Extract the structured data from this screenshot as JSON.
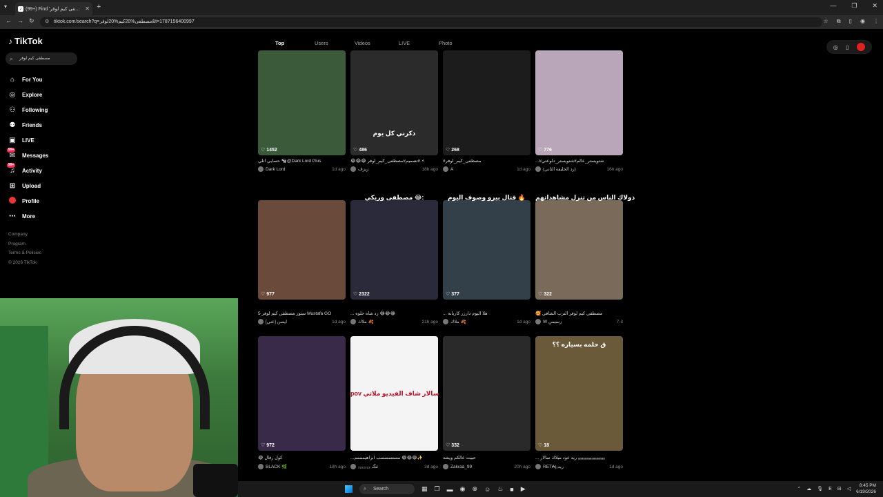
{
  "browser": {
    "tab_title": "(99+) Find 'مصطفى كيم لوفر' on...",
    "url": "tiktok.com/search?q=مصطفى%20كيم%20لوفر&t=1787156400997",
    "new_tab_label": "+",
    "window_controls": [
      "—",
      "❐",
      "✕"
    ]
  },
  "sidebar": {
    "logo_text": "TikTok",
    "search_value": "مصطفى كيم لوفر",
    "items": [
      {
        "label": "For You",
        "icon": "home-icon"
      },
      {
        "label": "Explore",
        "icon": "compass-icon"
      },
      {
        "label": "Following",
        "icon": "user-follow-icon"
      },
      {
        "label": "Friends",
        "icon": "friends-icon"
      },
      {
        "label": "LIVE",
        "icon": "live-icon"
      },
      {
        "label": "Messages",
        "icon": "message-icon",
        "badge": "99+"
      },
      {
        "label": "Activity",
        "icon": "bell-icon",
        "badge": "99+"
      },
      {
        "label": "Upload",
        "icon": "plus-icon"
      },
      {
        "label": "Profile",
        "icon": "avatar-icon"
      },
      {
        "label": "More",
        "icon": "more-icon"
      }
    ],
    "footer": [
      "Company",
      "Program",
      "Terms & Policies",
      "© 2026 TikTok"
    ]
  },
  "tabs": [
    "Top",
    "Users",
    "Videos",
    "LIVE",
    "Photo"
  ],
  "videos": [
    {
      "likes": "1452",
      "caption": "حسابي اتلي 🐄@Dark Lord Plus",
      "author": "Dark Lord",
      "time": "1d ago",
      "overlay": "",
      "bg": "#3a5a3a"
    },
    {
      "likes": "486",
      "caption": "😂😂😂 تصميم#مصطفى_كيم_لوفر# ⚡",
      "author": "زيزف",
      "time": "18h ago",
      "overlay": "ذكرني كل يوم",
      "bg": "#2b2b2b"
    },
    {
      "likes": "268",
      "caption": "#مصطفى_كيم_لوفر",
      "author": "A",
      "time": "1d ago",
      "overlay": "",
      "bg": "#1c1c1c"
    },
    {
      "likes": "776",
      "caption": "...#شتويستر_عالم#شتويستر_دلوعتي",
      "author": "(رد الخليفه الثاني)",
      "time": "16h ago",
      "overlay": "",
      "bg": "#b9a6b9"
    },
    {
      "likes": "977",
      "caption": "5 ستور مصطفى كيم لوفر Mustafa GO",
      "author": "ايسن [عني]",
      "time": "1d ago",
      "overlay": "",
      "bg": "#6a4a3a"
    },
    {
      "likes": "2322",
      "caption": "... زد شاه حلوه 😂😂😂",
      "author": "ملاك 🍂",
      "time": "21h ago",
      "overlay": "مصطفى وريكي 😂:",
      "bg": "#2a2a3a"
    },
    {
      "likes": "377",
      "caption": "... هلا اليوم داررر كاريانه",
      "author": "ملاك 🍂",
      "time": "1d ago",
      "overlay": "قتال بيرو وصوف اليوم 🔥",
      "bg": "#33404a"
    },
    {
      "likes": "322",
      "caption": "🥰 مصطفى كيم لوفر الترب الشافي",
      "author": "W زنميمن",
      "time": "7-3",
      "overlay": "ذولاك الناس من تنزل مشاهداتهم",
      "bg": "#7a6a5a"
    },
    {
      "likes": "972",
      "caption": "😂 كول رفال",
      "author": "BLACK 🌿",
      "time": "18h ago",
      "overlay": "",
      "bg": "#3a2a4a"
    },
    {
      "likes": "",
      "caption": "...مستسسسب ابراهيمممم 😂😂😂✨",
      "author": "ئتگ ₂₂₂₂₂₂₂",
      "time": "3d ago",
      "overlay": "pov سالار شاف الفيديو ملاتي",
      "bg": "#f4f4f4"
    },
    {
      "likes": "332",
      "caption": "حبيت عالكم ويشه",
      "author": "Zakraa_99",
      "time": "20h ago",
      "overlay": "",
      "bg": "#2a2a2a"
    },
    {
      "likes": "18",
      "caption": "... ريه عود ميلاك سالار ₐₐₐₐₐₐₐₐₐₐₐₐₐₐₐₐ",
      "author": "RET₳|₃ريد",
      "time": "1d ago",
      "overlay": "ق حلمه بسياره ؟؟",
      "bg": "#6a5a3a"
    }
  ],
  "taskbar": {
    "search_placeholder": "Search",
    "time": "8:45 PM",
    "date": "6/19/2026"
  }
}
